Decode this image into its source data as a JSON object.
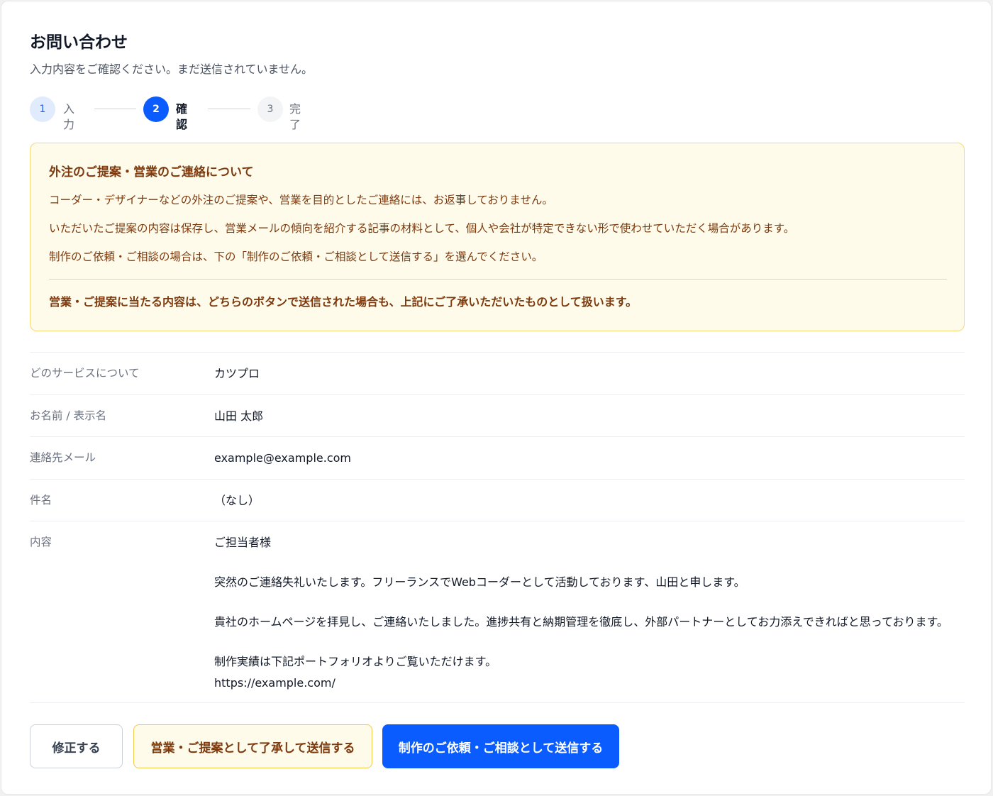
{
  "page": {
    "title": "お問い合わせ",
    "subtitle": "入力内容をご確認ください。まだ送信されていません。"
  },
  "steps": [
    {
      "number": "1",
      "label": "入力",
      "state": "done"
    },
    {
      "number": "2",
      "label": "確認",
      "state": "current"
    },
    {
      "number": "3",
      "label": "完了",
      "state": "upcoming"
    }
  ],
  "notice": {
    "title": "外注のご提案・営業のご連絡について",
    "paragraphs": [
      "コーダー・デザイナーなどの外注のご提案や、営業を目的としたご連絡には、お返事しておりません。",
      "いただいたご提案の内容は保存し、営業メールの傾向を紹介する記事の材料として、個人や会社が特定できない形で使わせていただく場合があります。",
      "制作のご依頼・ご相談の場合は、下の「制作のご依頼・ご相談として送信する」を選んでください。"
    ],
    "emphasis": "営業・ご提案に当たる内容は、どちらのボタンで送信された場合も、上記にご了承いただいたものとして扱います。"
  },
  "fields": {
    "service": {
      "label": "どのサービスについて",
      "value": "カツプロ"
    },
    "name": {
      "label": "お名前 / 表示名",
      "value": "山田 太郎"
    },
    "email": {
      "label": "連絡先メール",
      "value": "example@example.com"
    },
    "subject": {
      "label": "件名",
      "value": "（なし）"
    },
    "content": {
      "label": "内容",
      "lines": [
        "ご担当者様",
        "突然のご連絡失礼いたします。フリーランスでWebコーダーとして活動しております、山田と申します。",
        "貴社のホームページを拝見し、ご連絡いたしました。進捗共有と納期管理を徹底し、外部パートナーとしてお力添えできればと思っております。",
        "制作実績は下記ポートフォリオよりご覧いただけます。",
        "https://example.com/"
      ]
    }
  },
  "buttons": {
    "edit": "修正する",
    "sales": "営業・ご提案として了承して送信する",
    "request": "制作のご依頼・ご相談として送信する"
  },
  "colors": {
    "accent": "#0b5cff",
    "notice_bg": "#fffbeb",
    "notice_border": "#f5d97a",
    "notice_text": "#7c3a0e"
  }
}
